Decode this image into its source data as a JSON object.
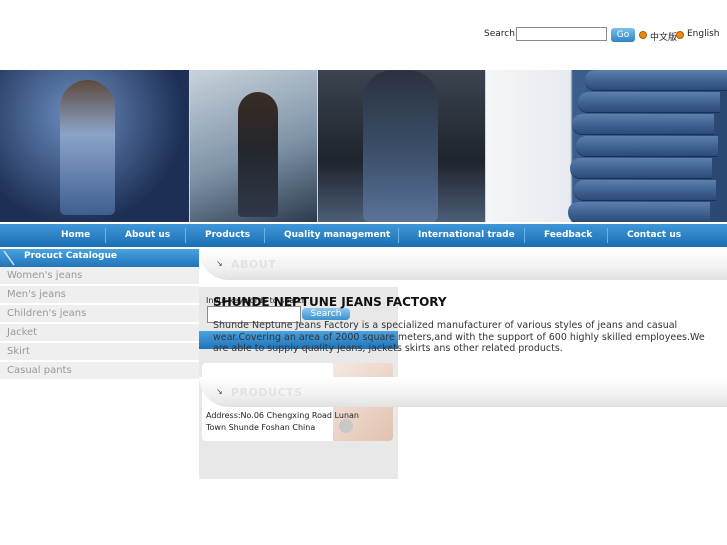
{
  "header": {
    "search_label": "Search:",
    "search_value": "",
    "go_label": "Go",
    "lang_cn": "中文版",
    "lang_en": "English"
  },
  "nav": [
    "Home",
    "About us",
    "Products",
    "Quality management",
    "International trade",
    "Feedback",
    "Contact us"
  ],
  "sidebar": {
    "title": "Procuct Catalogue",
    "items": [
      "Women's jeans",
      "Men's jeans",
      "Children's jeans",
      "Jacket",
      "Skirt",
      "Casual pants"
    ],
    "search_button": "Search",
    "search_hint": "Input keywords to search",
    "address": "Address:No.06 Chengxing Road Lunan Town Shunde Foshan China"
  },
  "about": {
    "heading": "ABOUT",
    "title": "SHUNDE NEPTUNE JEANS FACTORY",
    "text": "Shunde Neptune Jeans Factory is a specialized manufacturer of various styles of jeans and casual wear.Covering an area of 2000 square meters,and with the support of 600 highly skilled employees.We are able to supply quality jeans, jackets skirts ans other related products."
  },
  "products": {
    "heading": "PRODUCTS"
  },
  "colors": {
    "nav_blue": "#1a6fb2",
    "accent_orange": "#e88a1a"
  }
}
